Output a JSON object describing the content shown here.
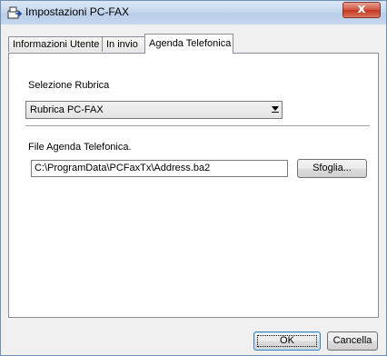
{
  "window": {
    "title": "Impostazioni PC-FAX",
    "close_symbol": "x"
  },
  "tabs": [
    {
      "label": "Informazioni Utente",
      "active": false
    },
    {
      "label": "In invio",
      "active": false
    },
    {
      "label": "Agenda Telefonica",
      "active": true
    }
  ],
  "address_book": {
    "label": "Selezione Rubrica",
    "selected": "Rubrica PC-FAX"
  },
  "file": {
    "label": "File Agenda Telefonica.",
    "path": "C:\\ProgramData\\PCFaxTx\\Address.ba2",
    "browse_label": "Sfoglia..."
  },
  "footer": {
    "ok_label": "OK",
    "cancel_label": "Cancella"
  },
  "colors": {
    "accent_close": "#c43621",
    "panel_bg": "#ffffff",
    "window_bg": "#f0f0f0"
  },
  "icons": {
    "app": "fax-device-icon",
    "dropdown": "chevron-down-icon"
  }
}
